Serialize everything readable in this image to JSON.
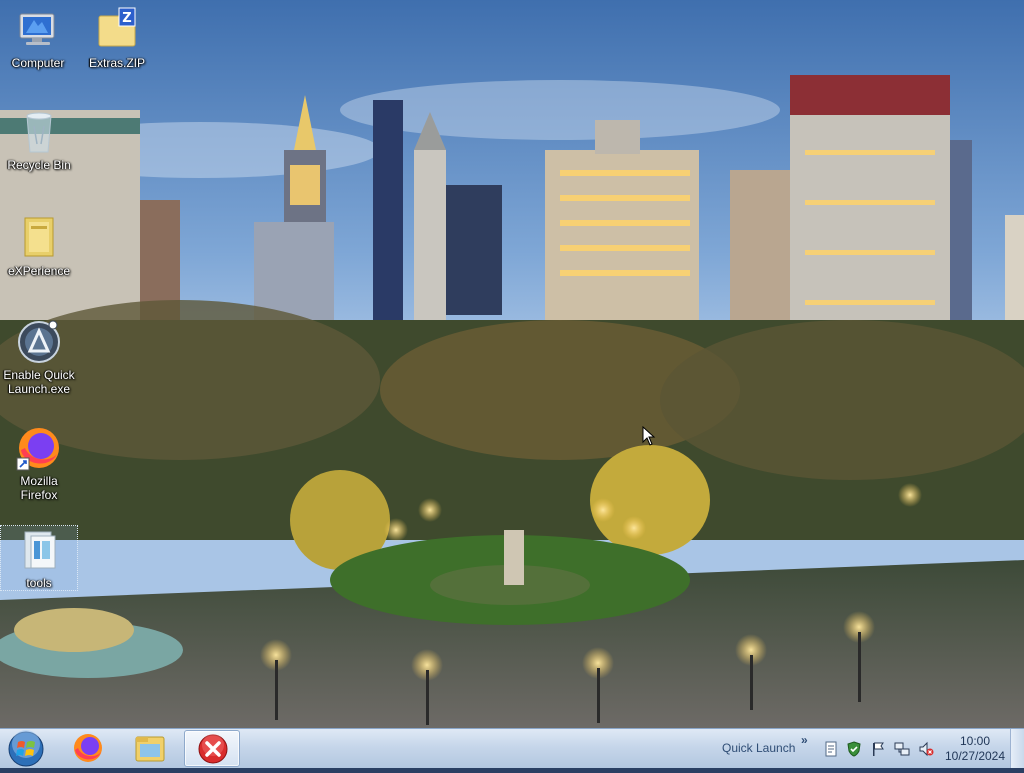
{
  "desktop": {
    "icons": [
      {
        "label": "Computer",
        "icon": "computer-icon"
      },
      {
        "label": "Extras.ZIP",
        "icon": "zip-folder-icon"
      },
      {
        "label": "Recycle Bin",
        "icon": "recycle-bin-icon"
      },
      {
        "label": "eXPerience",
        "icon": "folder-icon"
      },
      {
        "label": "Enable Quick Launch.exe",
        "icon": "quick-launch-exe-icon"
      },
      {
        "label": "Mozilla Firefox",
        "icon": "firefox-icon"
      },
      {
        "label": "tools",
        "icon": "folder-icon",
        "selected": true
      }
    ],
    "wallpaper": "city-park-evening"
  },
  "taskbar": {
    "start_icon": "windows-start-orb-icon",
    "pinned": [
      {
        "icon": "firefox-icon"
      },
      {
        "icon": "file-explorer-icon"
      },
      {
        "icon": "error-app-icon",
        "active": true
      }
    ],
    "quick_launch_label": "Quick Launch",
    "quick_launch_chevron": "»",
    "tray_icons": [
      "document-icon",
      "security-shield-icon",
      "action-center-flag-icon",
      "network-icon",
      "volume-muted-icon"
    ],
    "clock": {
      "time": "10:00",
      "date": "10/27/2024"
    }
  },
  "colors": {
    "taskbar_top": "#dfe9f5",
    "taskbar_bottom": "#b3c7e0",
    "label_text": "#ffffff"
  }
}
